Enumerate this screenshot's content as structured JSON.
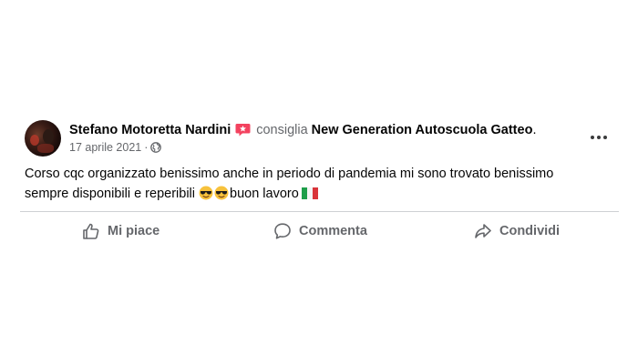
{
  "post": {
    "author": "Stefano Motoretta Nardini",
    "verb": "consiglia",
    "page_name": "New Generation Autoscuola Gatteo",
    "page_suffix": ".",
    "date": "17 aprile 2021",
    "separator": "·",
    "audience_icon": "globe-icon",
    "text_line1": "Corso cqc organizzato benissimo anche in periodo di pandemia mi sono trovato benissimo",
    "text_line2_start": "sempre disponibili e reperibili ",
    "text_line2_end": "buon lavoro",
    "emojis": [
      "sunglasses-emoji",
      "sunglasses-emoji",
      "italy-flag-emoji"
    ]
  },
  "actions": {
    "like_label": "Mi piace",
    "comment_label": "Commenta",
    "share_label": "Condividi"
  },
  "colors": {
    "text": "#050505",
    "secondary": "#65676b",
    "recommend": "#f3425f",
    "divider": "#ced0d4"
  }
}
